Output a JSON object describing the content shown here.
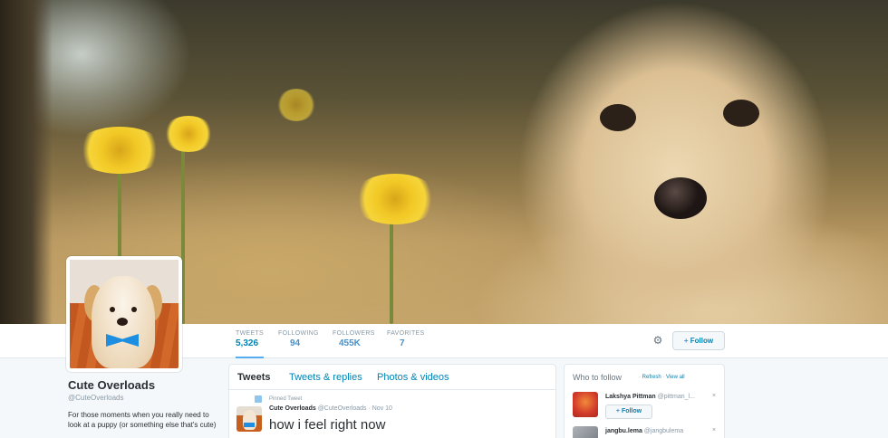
{
  "stats": [
    {
      "label": "TWEETS",
      "value": "5,326"
    },
    {
      "label": "FOLLOWING",
      "value": "94"
    },
    {
      "label": "FOLLOWERS",
      "value": "455K"
    },
    {
      "label": "FAVORITES",
      "value": "7"
    }
  ],
  "actions": {
    "gear_icon": "⚙",
    "follow_label": "Follow"
  },
  "profile": {
    "name": "Cute Overloads",
    "handle": "@CuteOverloads",
    "bio": "For those moments when you really need to look at a puppy (or something else that's cute)"
  },
  "timeline": {
    "tabs": [
      "Tweets",
      "Tweets & replies",
      "Photos & videos"
    ],
    "pinned_label": "Pinned Tweet",
    "tweet": {
      "author": "Cute Overloads",
      "handle": "@CuteOverloads",
      "date": "Nov 10",
      "text": "how i feel right now"
    }
  },
  "who_to_follow": {
    "title": "Who to follow",
    "refresh_label": "Refresh",
    "viewall_label": "View all",
    "users": [
      {
        "name": "Lakshya Pittman",
        "handle": "@pittman_l...",
        "follow_label": "Follow",
        "avatar_color": "#d23a2a"
      },
      {
        "name": "jangbu.lema",
        "handle": "@jangbulema",
        "follow_label": "",
        "avatar_color": "#8a8f96"
      }
    ]
  },
  "colors": {
    "link": "#0084b4",
    "accent": "#55acee"
  }
}
